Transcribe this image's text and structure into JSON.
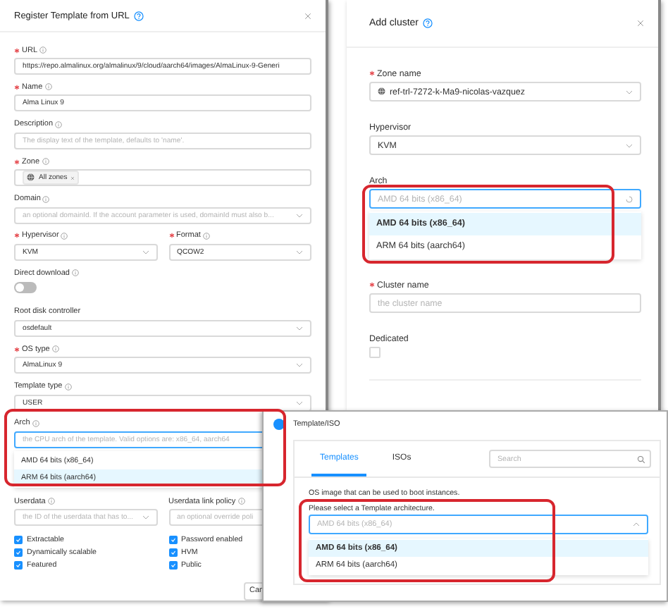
{
  "register_dialog": {
    "title": "Register Template from URL",
    "fields": [
      {
        "kind": "input",
        "label": "URL",
        "required": true,
        "info": true,
        "value": "https://repo.almalinux.org/almalinux/9/cloud/aarch64/images/AlmaLinux-9-Generi"
      },
      {
        "kind": "input",
        "label": "Name",
        "required": true,
        "info": true,
        "value": "Alma Linux 9"
      },
      {
        "kind": "input",
        "label": "Description",
        "required": false,
        "info": true,
        "placeholder": "The display text of the template, defaults to 'name'."
      },
      {
        "kind": "tags",
        "label": "Zone",
        "required": true,
        "info": true,
        "tags": [
          "All zones"
        ]
      },
      {
        "kind": "select",
        "label": "Domain",
        "required": false,
        "info": true,
        "placeholder": "an optional domainId. If the account parameter is used, domainId must also b..."
      },
      {
        "kind": "pair",
        "columns": [
          {
            "kind": "select",
            "label": "Hypervisor",
            "required": true,
            "info": true,
            "value": "KVM"
          },
          {
            "kind": "select",
            "label": "Format",
            "required": true,
            "info": true,
            "value": "QCOW2"
          }
        ]
      },
      {
        "kind": "toggle",
        "label": "Direct download",
        "required": false,
        "info": true,
        "on": false
      },
      {
        "kind": "select",
        "label": "Root disk controller",
        "required": false,
        "info": false,
        "value": "osdefault"
      },
      {
        "kind": "select",
        "label": "OS type",
        "required": true,
        "info": true,
        "value": "AlmaLinux 9"
      },
      {
        "kind": "select",
        "label": "Template type",
        "required": false,
        "info": true,
        "value": "USER"
      },
      {
        "kind": "input",
        "label": "Arch",
        "required": false,
        "info": true,
        "focused": true,
        "placeholder": "the CPU arch of the template. Valid options are: x86_64, aarch64",
        "options": [
          {
            "label": "AMD 64 bits (x86_64)",
            "selected": false,
            "active": false
          },
          {
            "label": "ARM 64 bits (aarch64)",
            "selected": false,
            "active": true
          }
        ]
      },
      {
        "kind": "pair",
        "columns": [
          {
            "kind": "select",
            "label": "Userdata",
            "required": false,
            "info": true,
            "placeholder": "the ID of the userdata that has to..."
          },
          {
            "kind": "input",
            "label": "Userdata link policy",
            "required": false,
            "info": true,
            "placeholder": "an optional override poli"
          }
        ]
      }
    ],
    "checkboxes": [
      {
        "label": "Extractable",
        "checked": true
      },
      {
        "label": "Password enabled",
        "checked": true
      },
      {
        "label": "Dynamically scalable",
        "checked": true
      },
      {
        "label": "HVM",
        "checked": true
      },
      {
        "label": "Featured",
        "checked": true
      },
      {
        "label": "Public",
        "checked": true
      }
    ],
    "button": "Can"
  },
  "cluster_dialog": {
    "title": "Add cluster",
    "fields": [
      {
        "kind": "zone",
        "label": "Zone name",
        "required": true,
        "value": "ref-trl-7272-k-Ma9-nicolas-vazquez"
      },
      {
        "kind": "select",
        "label": "Hypervisor",
        "required": false,
        "value": "KVM"
      },
      {
        "kind": "loading",
        "label": "Arch",
        "required": false,
        "focused": true,
        "placeholder": "AMD 64 bits (x86_64)",
        "options": [
          {
            "label": "AMD 64 bits (x86_64)",
            "selected": true,
            "active": true
          },
          {
            "label": "ARM 64 bits (aarch64)",
            "selected": false,
            "active": false
          }
        ]
      },
      {
        "kind": "input",
        "label": "Cluster name",
        "required": true,
        "placeholder": "the cluster name"
      },
      {
        "kind": "checkbox",
        "label": "Dedicated",
        "required": false,
        "checked": false
      }
    ]
  },
  "template_step": {
    "title": "Template/ISO",
    "tabs": [
      {
        "label": "Templates",
        "selected": true
      },
      {
        "label": "ISOs",
        "selected": false
      }
    ],
    "search": {
      "placeholder": "Search"
    },
    "description": "OS image that can be used to boot instances.",
    "arch": {
      "label": "Please select a Template architecture.",
      "placeholder": "AMD 64 bits (x86_64)",
      "focused": true,
      "open": true,
      "options": [
        {
          "label": "AMD 64 bits (x86_64)",
          "selected": true,
          "active": true
        },
        {
          "label": "ARM 64 bits (aarch64)",
          "selected": false,
          "active": false
        }
      ]
    }
  }
}
